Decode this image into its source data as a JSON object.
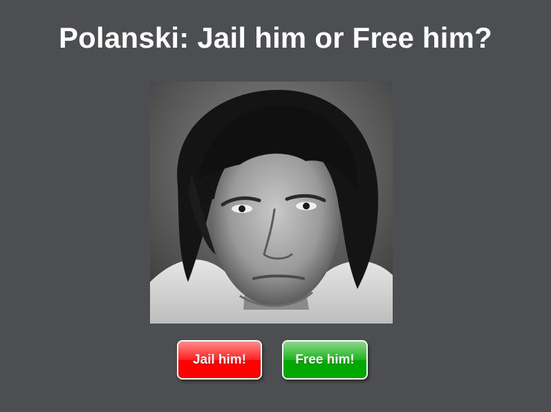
{
  "page": {
    "title": "Polanski: Jail him or Free him?"
  },
  "portrait": {
    "description_icon": "portrait-photo"
  },
  "buttons": {
    "jail_label": "Jail him!",
    "free_label": "Free him!"
  },
  "colors": {
    "background": "#4d4e52",
    "jail_button": "#ff0000",
    "free_button": "#00a800",
    "title_text": "#ffffff"
  }
}
